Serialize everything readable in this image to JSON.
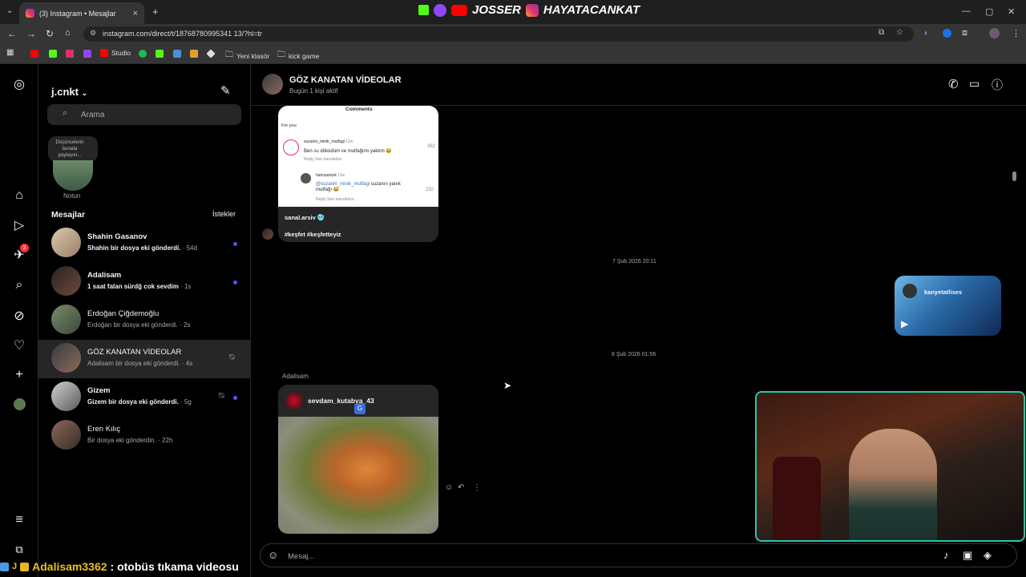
{
  "browser": {
    "tab_title": "(3) Instagram • Mesajlar",
    "url": "instagram.com/direct/t/18768780995341 13/?hl=tr",
    "bookmarks": [
      "Studio",
      "Yeni klasör",
      "kick game"
    ]
  },
  "stream_banner": {
    "left": "JOSSER",
    "right": "HAYATACANKAT"
  },
  "sidebar": {
    "username": "j.cnkt",
    "search_placeholder": "Arama",
    "note_bubble": "Düşüncelerin burada paylaşılır...",
    "note_label": "Notun",
    "messages_header": "Mesajlar",
    "requests_label": "İstekler",
    "notification_badge": "3",
    "conversations": [
      {
        "name": "Shahin Gasanov",
        "preview": "Shahin bir dosya eki gönderdi.",
        "time": "· 54d",
        "unread": true,
        "muted": false
      },
      {
        "name": "Adalisam",
        "preview": "1 saat falan sürdğ cok sevdim",
        "time": "· 1s",
        "unread": true,
        "muted": false
      },
      {
        "name": "Erdoğan Çiğdemoğlu",
        "preview": "Erdoğan bir dosya eki gönderdi.",
        "time": "· 2s",
        "unread": false,
        "muted": false
      },
      {
        "name": "GÖZ KANATAN VİDEOLAR",
        "preview": "Adalisam bir dosya eki gönderdi.",
        "time": "· 4s",
        "unread": false,
        "muted": true
      },
      {
        "name": "Gizem",
        "preview": "Gizem bir dosya eki gönderdi.",
        "time": "· 5g",
        "unread": true,
        "muted": true
      },
      {
        "name": "Eren Kılıç",
        "preview": "Bir dosya eki gönderdin.",
        "time": "· 22h",
        "unread": false,
        "muted": false
      }
    ]
  },
  "chat": {
    "title": "GÖZ KANATAN VİDEOLAR",
    "subtitle": "Bugün 1 kişi aktif",
    "post1": {
      "comments_header": "Comments",
      "for_you": "For you",
      "c1_user": "suzanin_minik_mutfagi",
      "c1_age": "12w",
      "c1_text": "Ben su döküdüm ve mutfağımı yaktım 😂",
      "c1_likes": "362",
      "c1_actions": "Reply    See translation",
      "c2_user": "hamzazturk",
      "c2_age": "11w",
      "c2_mention": "@suzanin_minik_mutfagi",
      "c2_text": "suzanın yanık mutfağı 😂",
      "c2_likes": "232",
      "c2_actions": "Reply    See translation",
      "author": "sanal.arsiv 🥶",
      "tags": "#keşfet #keşfetteyiz"
    },
    "date1": "7 Şub 2026 20:11",
    "reel_user": "kanyetatlises",
    "date2": "8 Şub 2026 01:56",
    "sender_label": "Adalisam",
    "post2_user": "sevdam_kutabya_43",
    "composer_placeholder": "Mesaj..."
  },
  "stream_chat": {
    "user": "Adalisam3362",
    "message": ": otobüs tıkama videosu"
  }
}
